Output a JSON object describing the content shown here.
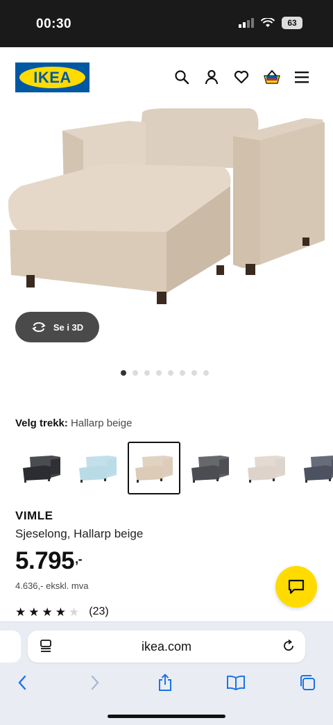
{
  "status_bar": {
    "time": "00:30",
    "battery": "63"
  },
  "header": {
    "logo_text": "IKEA"
  },
  "hero": {
    "view_3d_label": "Se i 3D",
    "dots_total": 8,
    "dots_active_index": 0
  },
  "cover": {
    "label": "Velg trekk:",
    "value": "Hallarp beige",
    "swatches": [
      {
        "color": "#2b2d33",
        "selected": false
      },
      {
        "color": "#b9dbe6",
        "selected": false
      },
      {
        "color": "#dccbb7",
        "selected": true
      },
      {
        "color": "#4b4d52",
        "selected": false
      },
      {
        "color": "#ddd3cb",
        "selected": false
      },
      {
        "color": "#4c5260",
        "selected": false
      }
    ]
  },
  "product": {
    "name": "VIMLE",
    "description": "Sjeselong, Hallarp beige",
    "price": "5.795",
    "price_suffix": ",-",
    "price_ex_vat": "4.636,- ekskl. mva",
    "rating_stars": 4,
    "rating_max": 5,
    "rating_count": "(23)"
  },
  "browser": {
    "url": "ikea.com"
  },
  "colors": {
    "ikea_blue": "#0058a3",
    "ikea_yellow": "#ffdb00",
    "ios_blue": "#1a73e8"
  }
}
